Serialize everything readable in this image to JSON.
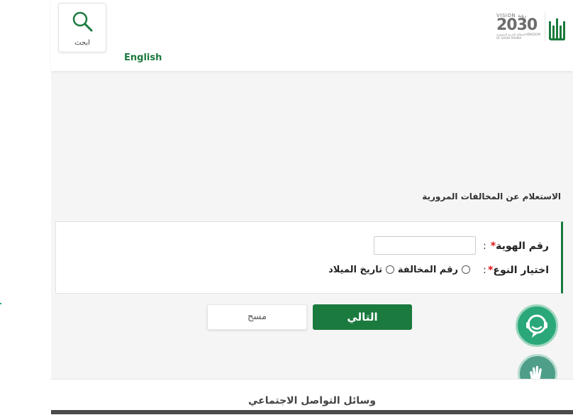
{
  "header": {
    "search_label": "ابحث",
    "language_link": "English",
    "vision_word": "VISION رؤية",
    "vision_year": "2030",
    "vision_sub": "المملكة العربية السعودية KINGDOM OF SAUDI ARABIA"
  },
  "page": {
    "title": "الاستعلام عن المخالفات المرورية"
  },
  "form": {
    "id_label": "رقم الهوية",
    "type_label": "اختيار النوع",
    "required_mark": "*",
    "colon": ":",
    "id_value": "",
    "options": [
      "رقم المخالفة",
      "تاريخ الميلاد"
    ]
  },
  "buttons": {
    "next": "التالي",
    "clear": "مسح"
  },
  "footer": {
    "title": "وسائل التواصل الاجتماعي"
  },
  "colors": {
    "brand_green": "#1b7a3e",
    "required_red": "#dd1111",
    "page_bg": "#f5f5f5"
  },
  "icons": [
    "search-icon",
    "absher-logo",
    "vision-2030-logo",
    "chat-support-icon",
    "sign-language-icon"
  ]
}
